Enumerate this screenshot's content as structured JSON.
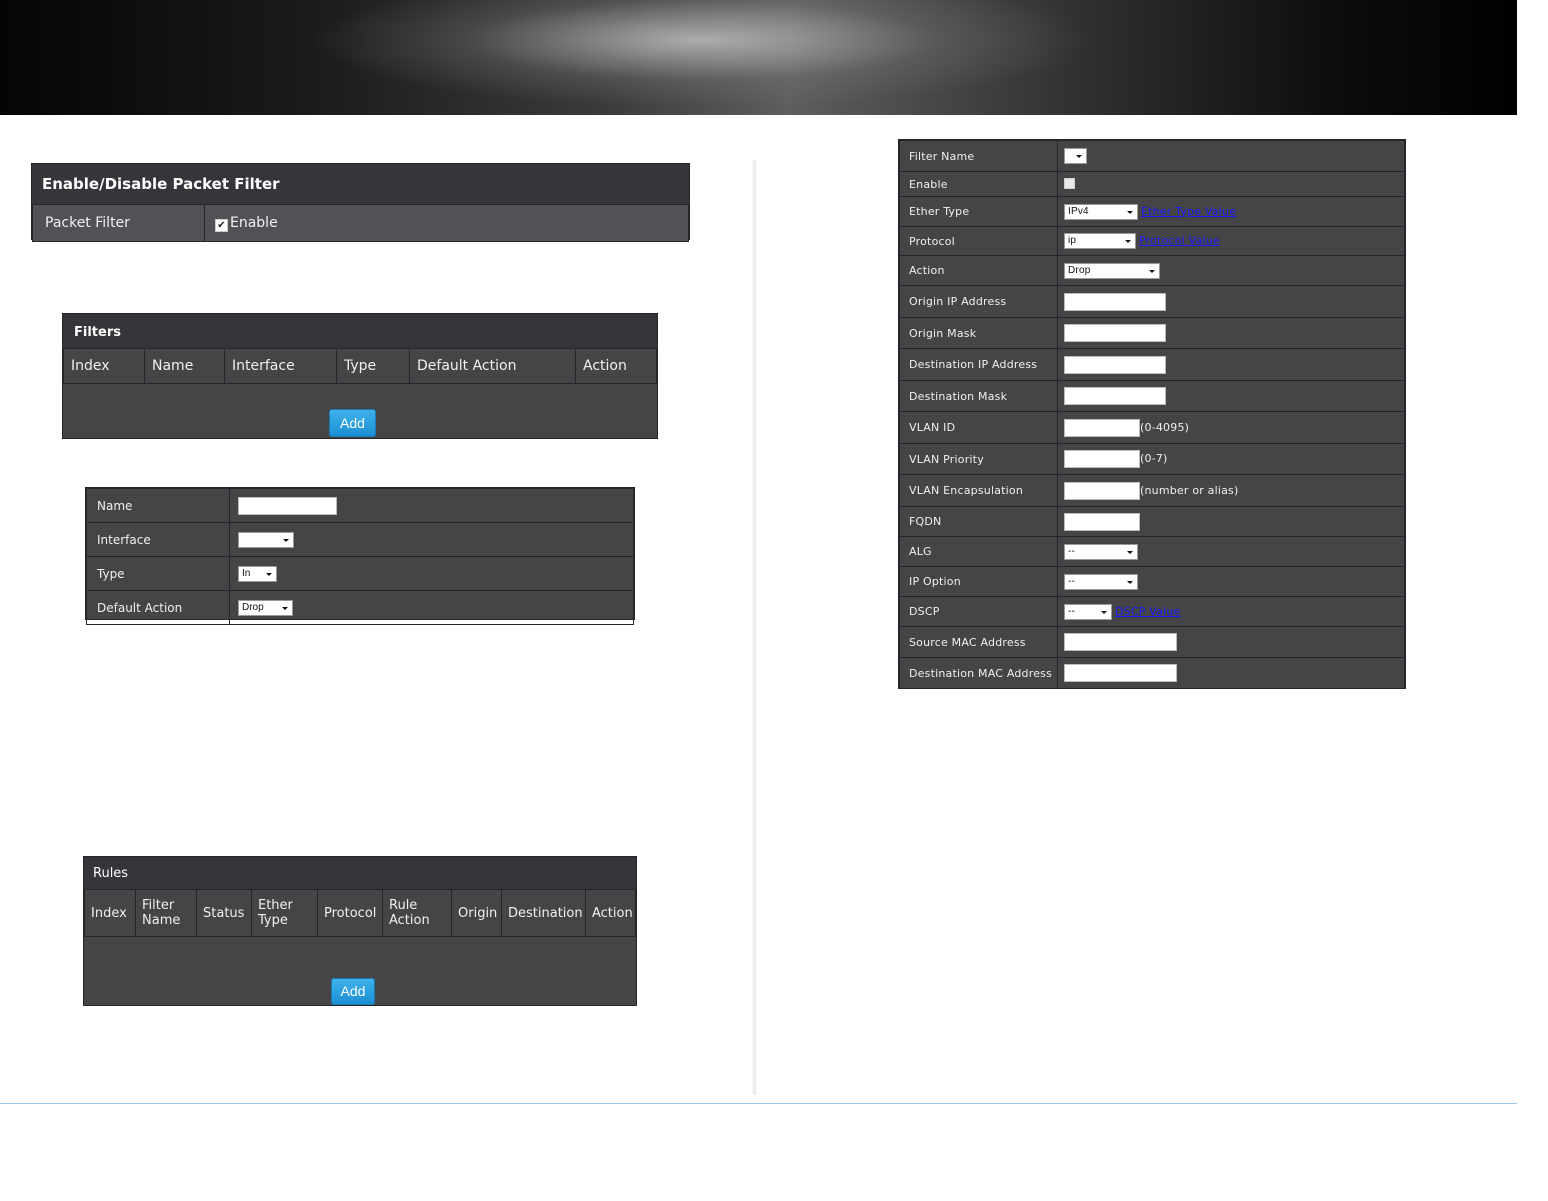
{
  "packet_filter": {
    "title": "Enable/Disable Packet Filter",
    "label": "Packet Filter",
    "checkbox_label": "Enable",
    "checked": true
  },
  "filters": {
    "title": "Filters",
    "columns": [
      "Index",
      "Name",
      "Interface",
      "Type",
      "Default Action",
      "Action"
    ],
    "add_label": "Add"
  },
  "filter_form": {
    "name_label": "Name",
    "interface_label": "Interface",
    "interface_value": "",
    "type_label": "Type",
    "type_value": "In",
    "default_action_label": "Default Action",
    "default_action_value": "Drop"
  },
  "rules": {
    "title": "Rules",
    "columns": [
      "Index",
      "Filter Name",
      "Status",
      "Ether Type",
      "Protocol",
      "Rule Action",
      "Origin",
      "Destination",
      "Action"
    ],
    "add_label": "Add"
  },
  "rule_form": {
    "filter_name_label": "Filter Name",
    "enable_label": "Enable",
    "ether_type_label": "Ether Type",
    "ether_type_value": "IPv4",
    "ether_type_link": "Ether Type Value",
    "protocol_label": "Protocol",
    "protocol_value": "ip",
    "protocol_link": "Protocol Value",
    "action_label": "Action",
    "action_value": "Drop",
    "origin_ip_label": "Origin IP Address",
    "origin_mask_label": "Origin Mask",
    "dest_ip_label": "Destination IP Address",
    "dest_mask_label": "Destination Mask",
    "vlan_id_label": "VLAN ID",
    "vlan_id_hint": "(0-4095)",
    "vlan_priority_label": "VLAN Priority",
    "vlan_priority_hint": "(0-7)",
    "vlan_encap_label": "VLAN Encapsulation",
    "vlan_encap_hint": "(number or alias)",
    "fqdn_label": "FQDN",
    "alg_label": "ALG",
    "alg_value": "--",
    "ip_option_label": "IP Option",
    "ip_option_value": "--",
    "dscp_label": "DSCP",
    "dscp_value": "--",
    "dscp_link": "DSCP Value",
    "src_mac_label": "Source MAC Address",
    "dest_mac_label": "Destination MAC Address"
  }
}
